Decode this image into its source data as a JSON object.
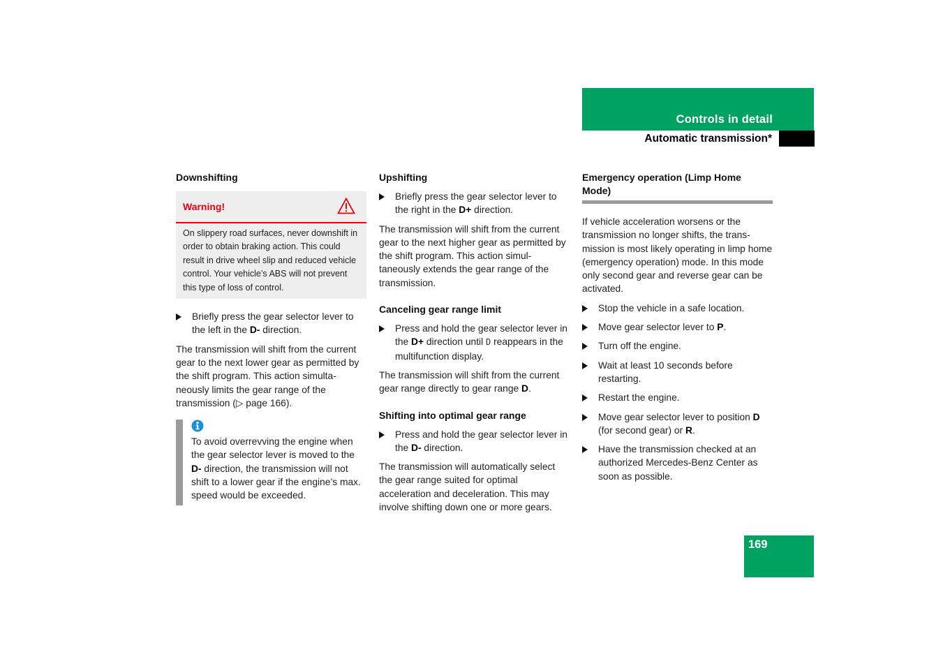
{
  "header": {
    "section_title": "Controls in detail",
    "subtitle": "Automatic transmission*",
    "page_number": "169",
    "accent_color": "#00a261"
  },
  "col1": {
    "heading": "Downshifting",
    "warning": {
      "title": "Warning!",
      "icon": "warning-triangle-icon",
      "color": "#e8000e",
      "body": "On slippery road surfaces, never downshift in order to obtain braking action. This could result in drive wheel slip and reduced vehicle control. Your vehicle’s ABS will not prevent this type of loss of control."
    },
    "bullet1": {
      "a": "Briefly press the gear selector lever to the left in the ",
      "b": "D-",
      "c": " direction."
    },
    "para1": "The transmission will shift from the current gear to the next lower gear as permitted by the shift program. This action simulta-neously limits the gear range of the transmission (▷ page 166).",
    "info": {
      "icon": "info-icon",
      "a": "To avoid overrevving the engine when the gear selector lever is moved to the ",
      "b": "D-",
      "c": " direction, the transmission will not shift to a lower gear if the engine’s max. speed would be exceeded."
    }
  },
  "col2": {
    "heading1": "Upshifting",
    "bullet1": {
      "a": "Briefly press the gear selector lever to the right in the ",
      "b": "D+",
      "c": " direction."
    },
    "para1": "The transmission will shift from the current gear to the next higher gear as permitted by the shift program. This action simul-taneously extends the gear range of the transmission.",
    "heading2": "Canceling gear range limit",
    "bullet2": {
      "a": "Press and hold the gear selector lever in the ",
      "b": "D+",
      "c": " direction until ",
      "d": "D",
      "e": " reappears in the multifunction display."
    },
    "para2": {
      "a": "The transmission will shift from the current gear range directly to gear range ",
      "b": "D",
      "c": "."
    },
    "heading3": "Shifting into optimal gear range",
    "bullet3": {
      "a": "Press and hold the gear selector lever in the ",
      "b": "D-",
      "c": " direction."
    },
    "para3": "The transmission will automatically select the gear range suited for optimal acceleration and deceleration. This may involve shifting down one or more gears."
  },
  "col3": {
    "heading": "Emergency operation (Limp Home Mode)",
    "intro": "If vehicle acceleration worsens or the transmission no longer shifts, the trans-mission is most likely operating in limp home (emergency operation) mode. In this mode only second gear and reverse gear can be activated.",
    "steps": {
      "s1": "Stop the vehicle in a safe location.",
      "s2a": "Move gear selector lever to ",
      "s2b": "P",
      "s2c": ".",
      "s3": "Turn off the engine.",
      "s4": "Wait at least 10 seconds before restarting.",
      "s5": "Restart the engine.",
      "s6a": "Move gear selector lever to position ",
      "s6b": "D",
      "s6c": " (for second gear) or ",
      "s6d": "R",
      "s6e": ".",
      "s7": "Have the transmission checked at an authorized Mercedes-Benz Center as soon as possible."
    }
  }
}
